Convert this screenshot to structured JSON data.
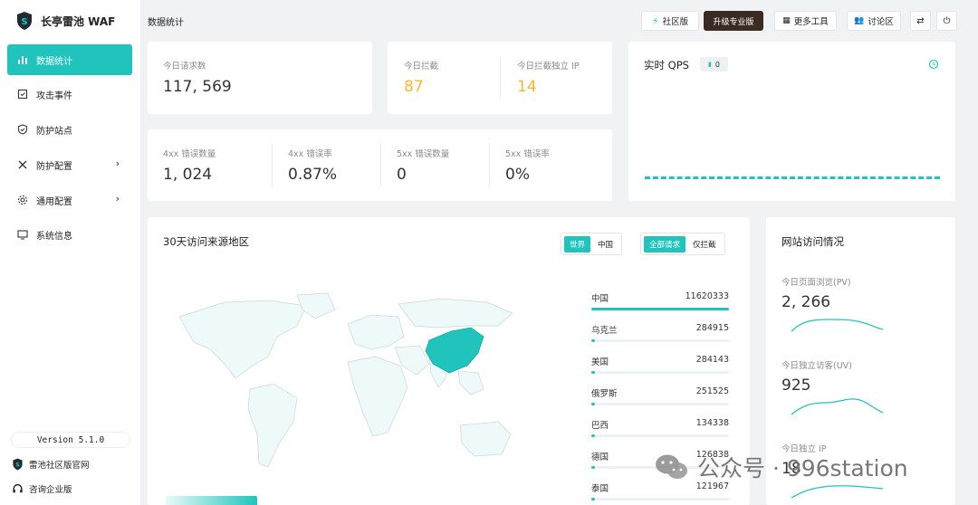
{
  "app": {
    "name": "长亭雷池 WAF",
    "version": "Version 5.1.0"
  },
  "sidebar": {
    "items": [
      {
        "label": "数据统计",
        "icon": "bar-chart-icon"
      },
      {
        "label": "攻击事件",
        "icon": "event-icon"
      },
      {
        "label": "防护站点",
        "icon": "shield-icon"
      },
      {
        "label": "防护配置",
        "icon": "tools-icon"
      },
      {
        "label": "通用配置",
        "icon": "gear-icon"
      },
      {
        "label": "系统信息",
        "icon": "monitor-icon"
      }
    ],
    "links": {
      "official": "雷池社区版官网",
      "enterprise": "咨询企业版"
    }
  },
  "header": {
    "title": "数据统计",
    "community_label": "社区版",
    "upgrade_label": "升级专业版",
    "tools_label": "更多工具",
    "forum_label": "讨论区"
  },
  "stats": {
    "requests": {
      "label": "今日请求数",
      "value": "117, 569"
    },
    "blocked": {
      "label": "今日拦截",
      "value": "87"
    },
    "blocked_ip": {
      "label": "今日拦截独立 IP",
      "value": "14"
    },
    "err4_count": {
      "label": "4xx 错误数量",
      "value": "1, 024"
    },
    "err4_rate": {
      "label": "4xx 错误率",
      "value": "0.87%"
    },
    "err5_count": {
      "label": "5xx 错误数量",
      "value": "0"
    },
    "err5_rate": {
      "label": "5xx 错误率",
      "value": "0%"
    }
  },
  "qps": {
    "title": "实时 QPS",
    "badge": "0"
  },
  "geo": {
    "title": "30天访问来源地区",
    "toggle1": [
      "世界",
      "中国"
    ],
    "toggle2": [
      "全部请求",
      "仅拦截"
    ],
    "countries": [
      {
        "name": "中国",
        "value": "11620333",
        "ratio": 1.0
      },
      {
        "name": "乌克兰",
        "value": "284915",
        "ratio": 0.025
      },
      {
        "name": "美国",
        "value": "284143",
        "ratio": 0.025
      },
      {
        "name": "俄罗斯",
        "value": "251525",
        "ratio": 0.022
      },
      {
        "name": "巴西",
        "value": "134338",
        "ratio": 0.012
      },
      {
        "name": "德国",
        "value": "126838",
        "ratio": 0.011
      },
      {
        "name": "泰国",
        "value": "121967",
        "ratio": 0.01
      }
    ]
  },
  "visits": {
    "title": "网站访问情况",
    "pv": {
      "label": "今日页面浏览(PV)",
      "value": "2, 266"
    },
    "uv": {
      "label": "今日独立访客(UV)",
      "value": "925"
    },
    "ip": {
      "label": "今日独立 IP",
      "value": "18"
    }
  },
  "watermark": {
    "text": "公众号 · 996station"
  },
  "colors": {
    "accent": "#20c4bd",
    "warning": "#f5b731",
    "upgrade": "#3b2a21"
  }
}
